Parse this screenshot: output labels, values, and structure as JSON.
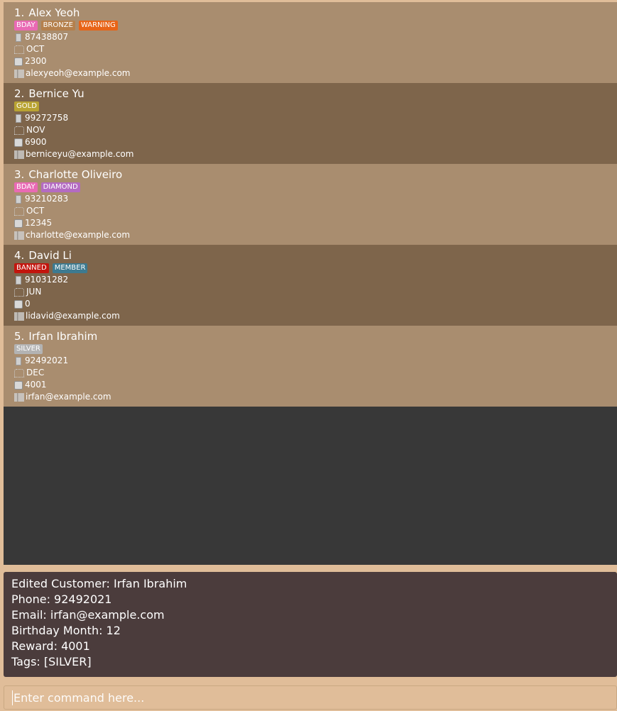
{
  "customers": [
    {
      "index": "1.",
      "name": "Alex Yeoh",
      "tags": [
        {
          "label": "BDAY",
          "color": "#e96ab4"
        },
        {
          "label": "BRONZE",
          "color": "#b5804c"
        },
        {
          "label": "WARNING",
          "color": "#e86418"
        }
      ],
      "phone": "87438807",
      "birthday": "OCT",
      "reward": "2300",
      "email": "alexyeoh@example.com"
    },
    {
      "index": "2.",
      "name": "Bernice Yu",
      "tags": [
        {
          "label": "GOLD",
          "color": "#b9a332"
        }
      ],
      "phone": "99272758",
      "birthday": "NOV",
      "reward": "6900",
      "email": "berniceyu@example.com"
    },
    {
      "index": "3.",
      "name": "Charlotte Oliveiro",
      "tags": [
        {
          "label": "BDAY",
          "color": "#e96ab4"
        },
        {
          "label": "DIAMOND",
          "color": "#b46bc2"
        }
      ],
      "phone": "93210283",
      "birthday": "OCT",
      "reward": "12345",
      "email": "charlotte@example.com"
    },
    {
      "index": "4.",
      "name": "David Li",
      "tags": [
        {
          "label": "BANNED",
          "color": "#c3150d"
        },
        {
          "label": "MEMBER",
          "color": "#3d7a90"
        }
      ],
      "phone": "91031282",
      "birthday": "JUN",
      "reward": "0",
      "email": "lidavid@example.com"
    },
    {
      "index": "5.",
      "name": "Irfan Ibrahim",
      "tags": [
        {
          "label": "SILVER",
          "color": "#b3b3b3"
        }
      ],
      "phone": "92492021",
      "birthday": "DEC",
      "reward": "4001",
      "email": "irfan@example.com"
    }
  ],
  "icons": {
    "phone": "phone-icon",
    "birthday": "cake-icon",
    "reward": "gift-icon",
    "email": "mail-icon"
  },
  "result": {
    "lines": [
      "Edited Customer: Irfan Ibrahim",
      "Phone: 92492021",
      "Email: irfan@example.com",
      "Birthday Month: 12",
      "Reward: 4001",
      "Tags: [SILVER]"
    ]
  },
  "command": {
    "placeholder": "Enter command here..."
  }
}
